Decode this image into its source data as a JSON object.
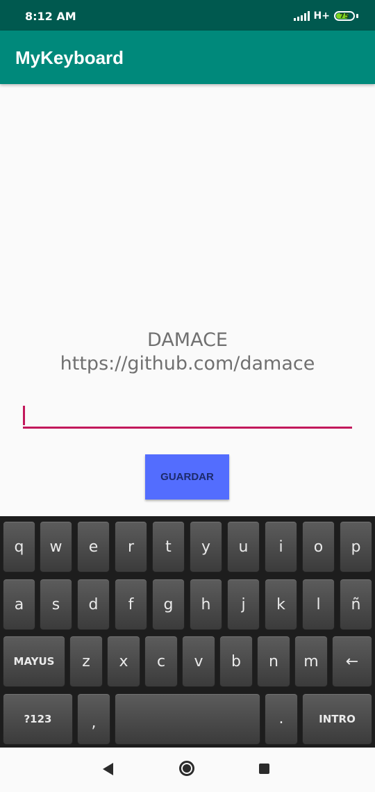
{
  "status_bar": {
    "time": "8:12 AM",
    "network": "H+",
    "battery": "75",
    "battery_level_percent": 75
  },
  "app_bar": {
    "title": "MyKeyboard"
  },
  "main": {
    "text_line1": "DAMACE",
    "text_line2": "https://github.com/damace",
    "input": {
      "value": "",
      "placeholder": ""
    },
    "save_label": "GUARDAR"
  },
  "keyboard": {
    "row1": [
      "q",
      "w",
      "e",
      "r",
      "t",
      "y",
      "u",
      "i",
      "o",
      "p"
    ],
    "row2": [
      "a",
      "s",
      "d",
      "f",
      "g",
      "h",
      "j",
      "k",
      "l",
      "ñ"
    ],
    "row3": [
      "MAYUS",
      "z",
      "x",
      "c",
      "v",
      "b",
      "n",
      "m",
      "←"
    ],
    "row4": [
      "?123",
      ",",
      "",
      ".",
      "INTRO"
    ]
  },
  "nav_bar": {
    "icons": [
      "back-icon",
      "home-icon",
      "recents-icon"
    ]
  },
  "colors": {
    "primary": "#00897b",
    "primary_dark": "#00594f",
    "accent": "#c2185b",
    "button": "#536dfe"
  }
}
